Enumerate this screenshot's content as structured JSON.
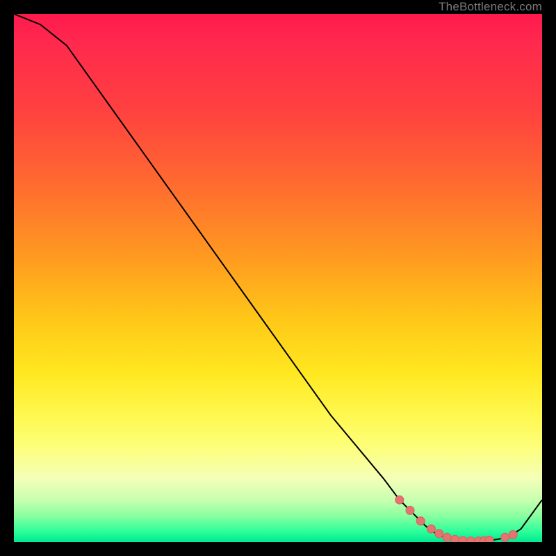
{
  "watermark": "TheBottleneck.com",
  "colors": {
    "curve_stroke": "#000000",
    "marker_fill": "#e5736f",
    "marker_stroke": "#d85f5b"
  },
  "chart_data": {
    "type": "line",
    "title": "",
    "xlabel": "",
    "ylabel": "",
    "xlim": [
      0,
      100
    ],
    "ylim": [
      0,
      100
    ],
    "x": [
      0,
      5,
      10,
      15,
      20,
      25,
      30,
      35,
      40,
      45,
      50,
      55,
      60,
      65,
      70,
      73,
      76,
      78,
      80,
      82,
      84,
      86,
      88,
      90,
      92,
      94,
      96,
      100
    ],
    "values": [
      100,
      98,
      94,
      87,
      80,
      73,
      66,
      59,
      52,
      45,
      38,
      31,
      24,
      18,
      12,
      8,
      5,
      3,
      1.5,
      0.7,
      0.3,
      0.2,
      0.2,
      0.3,
      0.6,
      1.2,
      2.5,
      8
    ],
    "markers": {
      "x": [
        73,
        75,
        77,
        79,
        80.5,
        82,
        83.5,
        85,
        86.5,
        88,
        89,
        90,
        93,
        94.5
      ],
      "values": [
        8,
        6,
        4,
        2.5,
        1.6,
        0.9,
        0.5,
        0.3,
        0.2,
        0.2,
        0.25,
        0.35,
        0.9,
        1.4
      ]
    }
  }
}
